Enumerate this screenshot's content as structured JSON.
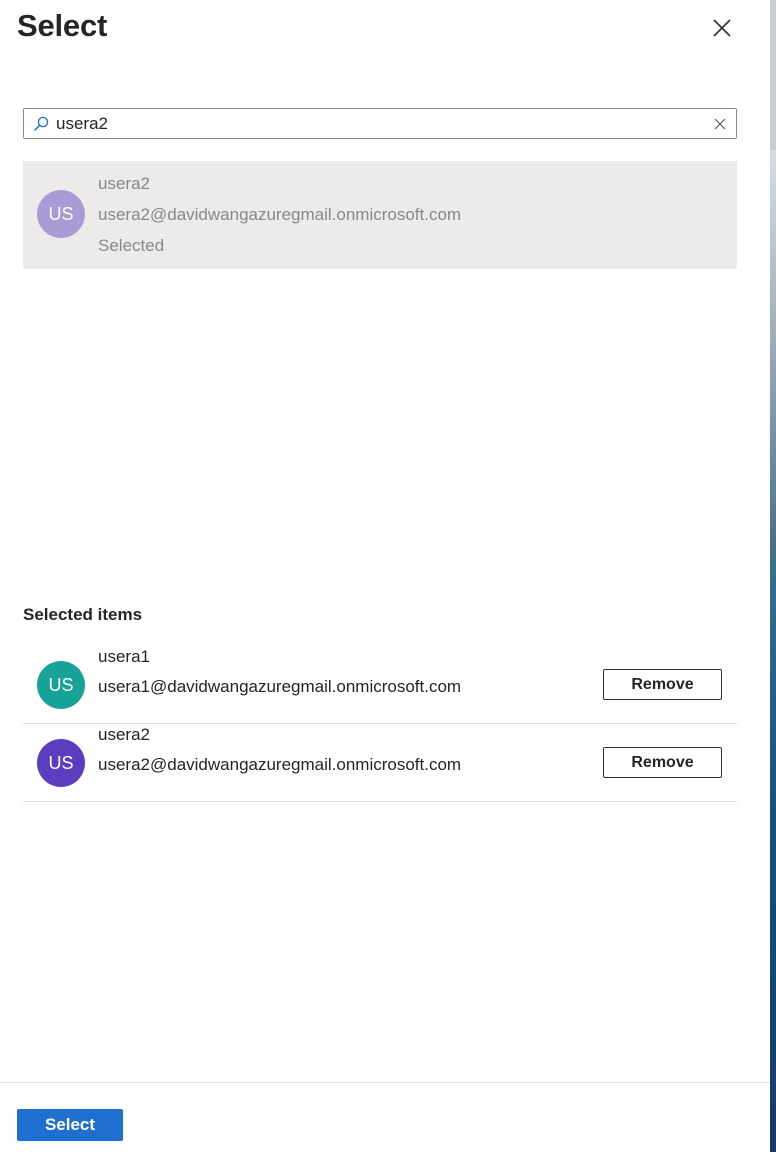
{
  "header": {
    "title": "Select",
    "close_icon": "close-icon"
  },
  "search": {
    "value": "usera2",
    "icon": "search-icon",
    "clear_icon": "clear-icon"
  },
  "result": {
    "initials": "US",
    "avatar_color": "#a99bd6",
    "name": "usera2",
    "email": "usera2@davidwangazuregmail.onmicrosoft.com",
    "status": "Selected"
  },
  "selected": {
    "heading": "Selected items",
    "items": [
      {
        "initials": "US",
        "avatar_color": "#17a398",
        "name": "usera1",
        "email": "usera1@davidwangazuregmail.onmicrosoft.com",
        "remove_label": "Remove"
      },
      {
        "initials": "US",
        "avatar_color": "#5c3dbf",
        "name": "usera2",
        "email": "usera2@davidwangazuregmail.onmicrosoft.com",
        "remove_label": "Remove"
      }
    ]
  },
  "footer": {
    "select_label": "Select"
  },
  "colors": {
    "primary": "#1f6fd0",
    "selected_row_bg": "#ecebea",
    "text": "#252525",
    "muted_text": "#8a8886"
  }
}
